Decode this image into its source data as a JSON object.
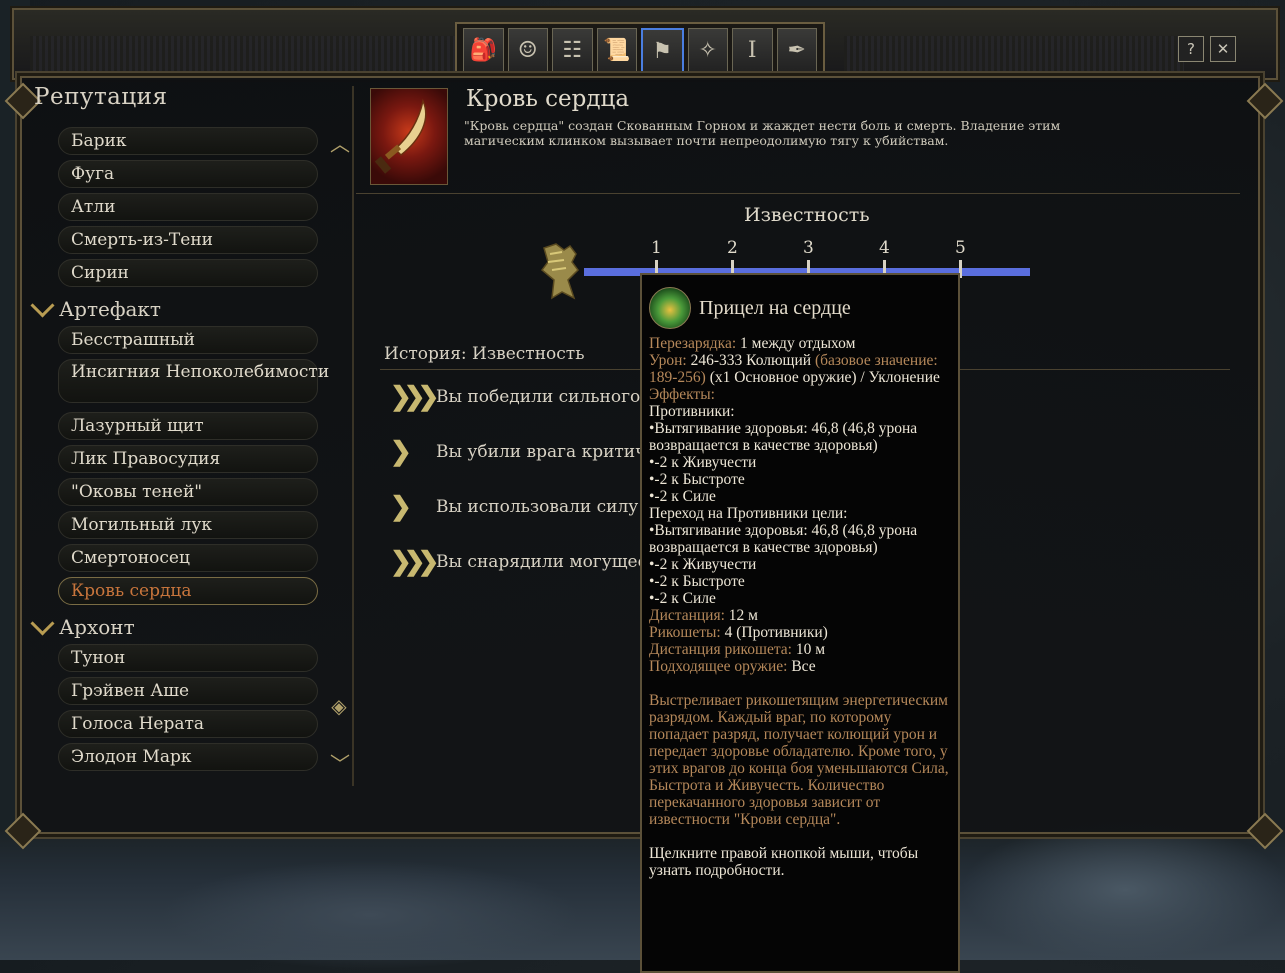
{
  "window": {
    "tabs": [
      {
        "icon": "backpack-icon",
        "glyph": "🎒"
      },
      {
        "icon": "character-icon",
        "glyph": "☺"
      },
      {
        "icon": "party-tree-icon",
        "glyph": "☷"
      },
      {
        "icon": "journal-scroll-icon",
        "glyph": "📜"
      },
      {
        "icon": "reputation-banner-icon",
        "glyph": "⚑"
      },
      {
        "icon": "compass-star-icon",
        "glyph": "✧"
      },
      {
        "icon": "pillar-icon",
        "glyph": "Ⅰ"
      },
      {
        "icon": "quill-icon",
        "glyph": "✒"
      }
    ],
    "help_label": "?",
    "close_label": "✕"
  },
  "sidebar": {
    "title": "Репутация",
    "items": [
      {
        "label": "Барик"
      },
      {
        "label": "Фуга"
      },
      {
        "label": "Атли"
      },
      {
        "label": "Смерть-из-Тени"
      },
      {
        "label": "Сирин"
      }
    ],
    "categories": [
      {
        "label": "Артефакт",
        "items": [
          {
            "label": "Бесстрашный"
          },
          {
            "label": "Инсигния Непоколебимости"
          },
          {
            "label": "Лазурный щит"
          },
          {
            "label": "Лик Правосудия"
          },
          {
            "label": "\"Оковы теней\""
          },
          {
            "label": "Могильный лук"
          },
          {
            "label": "Смертоносец"
          },
          {
            "label": "Кровь сердца"
          }
        ]
      },
      {
        "label": "Архонт",
        "items": [
          {
            "label": "Тунон"
          },
          {
            "label": "Грэйвен Аше"
          },
          {
            "label": "Голоса Нерата"
          },
          {
            "label": "Элодон Марк"
          }
        ]
      }
    ]
  },
  "artifact": {
    "title": "Кровь сердца",
    "description": "\"Кровь сердца\" создан Скованным Горном и жаждет нести боль и смерть. Владение этим магическим клинком вызывает почти непреодолимую тягу к убийствам."
  },
  "fame": {
    "title": "Известность",
    "levels": [
      "1",
      "2",
      "3",
      "4",
      "5"
    ],
    "bar_color": "#5a6ede"
  },
  "history": {
    "title": "История: Известность",
    "items": [
      {
        "text": "Вы победили сильного",
        "icon": "triple-chevron-icon"
      },
      {
        "text": "Вы убили врага критиче",
        "icon": "single-chevron-icon"
      },
      {
        "text": "Вы использовали силу",
        "icon": "single-chevron-icon"
      },
      {
        "text": "Вы снарядили могущес",
        "icon": "triple-chevron-icon"
      }
    ]
  },
  "tooltip": {
    "title": "Прицел на сердце",
    "recharge_label": "Перезарядка:",
    "recharge_value": "1 между отдыхом",
    "damage_label": "Урон:",
    "damage_value": "246-333 Колющий",
    "damage_base": "(базовое значение: 189-256)",
    "damage_extra": "(x1 Основное оружие) / Уклонение",
    "effects_label": "Эффекты:",
    "enemies_label": "Противники:",
    "effect_lines_1": [
      "•Вытягивание здоровья: 46,8 (46,8 урона возвращается в качестве здоровья)",
      "•-2 к Живучести",
      "•-2 к Быстроте",
      "•-2 к Силе"
    ],
    "transfer_label": "Переход на Противники цели:",
    "effect_lines_2": [
      "•Вытягивание здоровья: 46,8 (46,8 урона возвращается в качестве здоровья)",
      "•-2 к Живучести",
      "•-2 к Быстроте",
      "•-2 к Силе"
    ],
    "range_label": "Дистанция:",
    "range_value": "12 м",
    "bounces_label": "Рикошеты:",
    "bounces_value": "4 (Противники)",
    "bounce_range_label": "Дистанция рикошета:",
    "bounce_range_value": "10 м",
    "weapon_label": "Подходящее оружие:",
    "weapon_value": "Все",
    "flavor": "Выстреливает рикошетящим энергетическим разрядом. Каждый враг, по которому попадает разряд, получает колющий урон и передает здоровье обладателю. Кроме того, у этих врагов до конца боя уменьшаются Сила, Быстрота и Живучесть. Количество перекачанного здоровья зависит от известности \"Крови сердца\".",
    "hint": "Щелкните правой кнопкой мыши, чтобы узнать подробности."
  }
}
